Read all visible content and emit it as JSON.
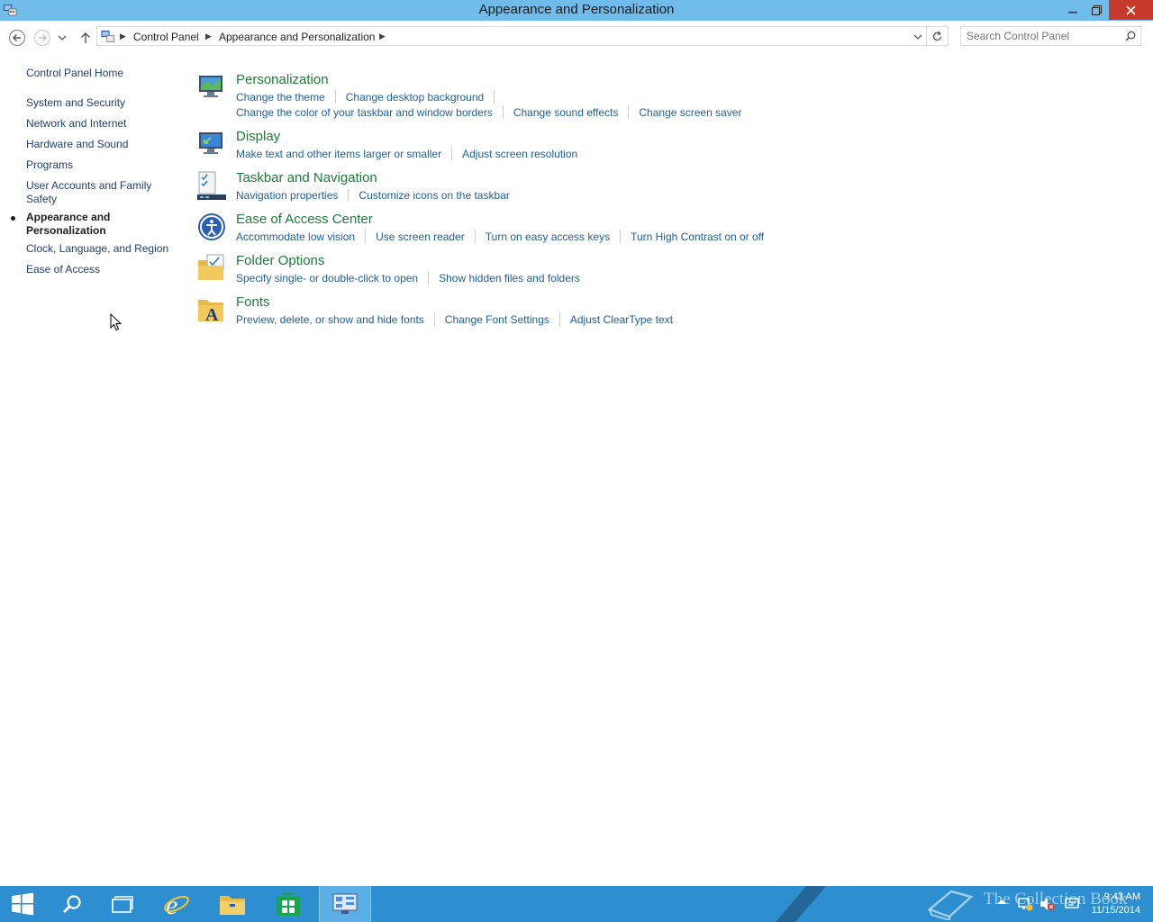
{
  "window": {
    "title": "Appearance and Personalization",
    "controls": {
      "minimize": "–",
      "restore": "❐",
      "close": "✕"
    }
  },
  "address_bar": {
    "breadcrumbs": [
      "Control Panel",
      "Appearance and Personalization"
    ]
  },
  "search": {
    "placeholder": "Search Control Panel"
  },
  "sidebar": {
    "home": "Control Panel Home",
    "items": [
      "System and Security",
      "Network and Internet",
      "Hardware and Sound",
      "Programs",
      "User Accounts and Family Safety",
      "Appearance and Personalization",
      "Clock, Language, and Region",
      "Ease of Access"
    ],
    "current_index": 5
  },
  "categories": [
    {
      "title": "Personalization",
      "icon": "personalization-icon",
      "lines": [
        [
          "Change the theme",
          "Change desktop background"
        ],
        [
          "Change the color of your taskbar and window borders",
          "Change sound effects",
          "Change screen saver"
        ]
      ]
    },
    {
      "title": "Display",
      "icon": "display-icon",
      "lines": [
        [
          "Make text and other items larger or smaller",
          "Adjust screen resolution"
        ]
      ]
    },
    {
      "title": "Taskbar and Navigation",
      "icon": "taskbar-icon",
      "lines": [
        [
          "Navigation properties",
          "Customize icons on the taskbar"
        ]
      ]
    },
    {
      "title": "Ease of Access Center",
      "icon": "ease-of-access-icon",
      "lines": [
        [
          "Accommodate low vision",
          "Use screen reader",
          "Turn on easy access keys",
          "Turn High Contrast on or off"
        ]
      ]
    },
    {
      "title": "Folder Options",
      "icon": "folder-options-icon",
      "lines": [
        [
          "Specify single- or double-click to open",
          "Show hidden files and folders"
        ]
      ]
    },
    {
      "title": "Fonts",
      "icon": "fonts-icon",
      "lines": [
        [
          "Preview, delete, or show and hide fonts",
          "Change Font Settings",
          "Adjust ClearType text"
        ]
      ]
    }
  ],
  "taskbar": {
    "apps": [
      "start-icon",
      "search-icon",
      "task-view-icon",
      "internet-explorer-icon",
      "file-explorer-icon",
      "store-icon",
      "control-panel-icon"
    ],
    "watermark": "The Collection Book",
    "time": "9:43 AM",
    "date": "11/15/2014"
  },
  "colors": {
    "titlebar": "#6fbcea",
    "taskbar": "#2d8fd0",
    "category_title": "#1e7a3a",
    "link": "#1e5fa0",
    "close_button": "#c7392b"
  }
}
